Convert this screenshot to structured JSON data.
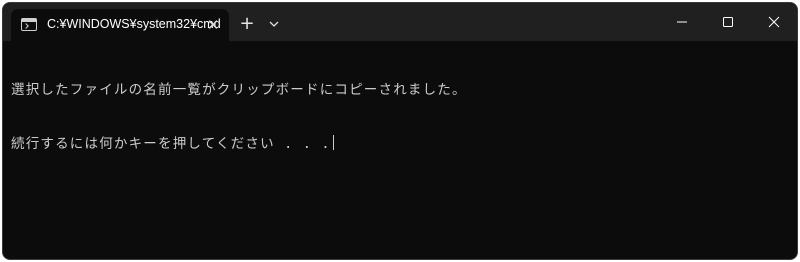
{
  "window": {
    "tab_title": "C:¥WINDOWS¥system32¥cmd",
    "tab_close_glyph": "✕",
    "new_tab_glyph": "+"
  },
  "console": {
    "lines": [
      "選択したファイルの名前一覧がクリップボードにコピーされました。",
      "続行するには何かキーを押してください . . ."
    ]
  },
  "colors": {
    "background": "#0c0c0c",
    "titlebar": "#202020",
    "text": "#cccccc"
  },
  "icons": [
    "terminal-icon",
    "close-icon",
    "plus-icon",
    "chevron-down-icon",
    "minimize-icon",
    "maximize-icon",
    "window-close-icon"
  ]
}
